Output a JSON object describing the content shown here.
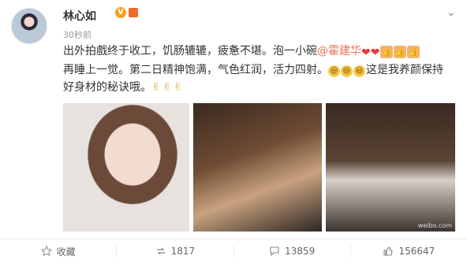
{
  "post": {
    "username": "林心如",
    "verified_badge": "V",
    "time": "30秒前",
    "lines": [
      {
        "before": "出外拍戲终于收工，饥肠辘辘，疲惫不堪。泡一小碗",
        "mention": "@霍建华",
        "after": ""
      },
      {
        "text1": "再睡上一觉。第二日精神饱满，气色红润，活力四射。",
        "text2": "这是我养颜保持"
      },
      {
        "text": "好身材的秘诀哦。"
      }
    ],
    "watermark": "weibo.com"
  },
  "icons": {
    "avatar": "avatar",
    "chevron": "chevron-down-icon",
    "heart": "heart-icon",
    "thumb": "thumbs-up-icon",
    "smile": "laughing-face-icon",
    "victory": "victory-hand-icon"
  },
  "actions": {
    "favorite": "收藏",
    "repost": "1817",
    "comment": "13859",
    "like": "156647"
  }
}
